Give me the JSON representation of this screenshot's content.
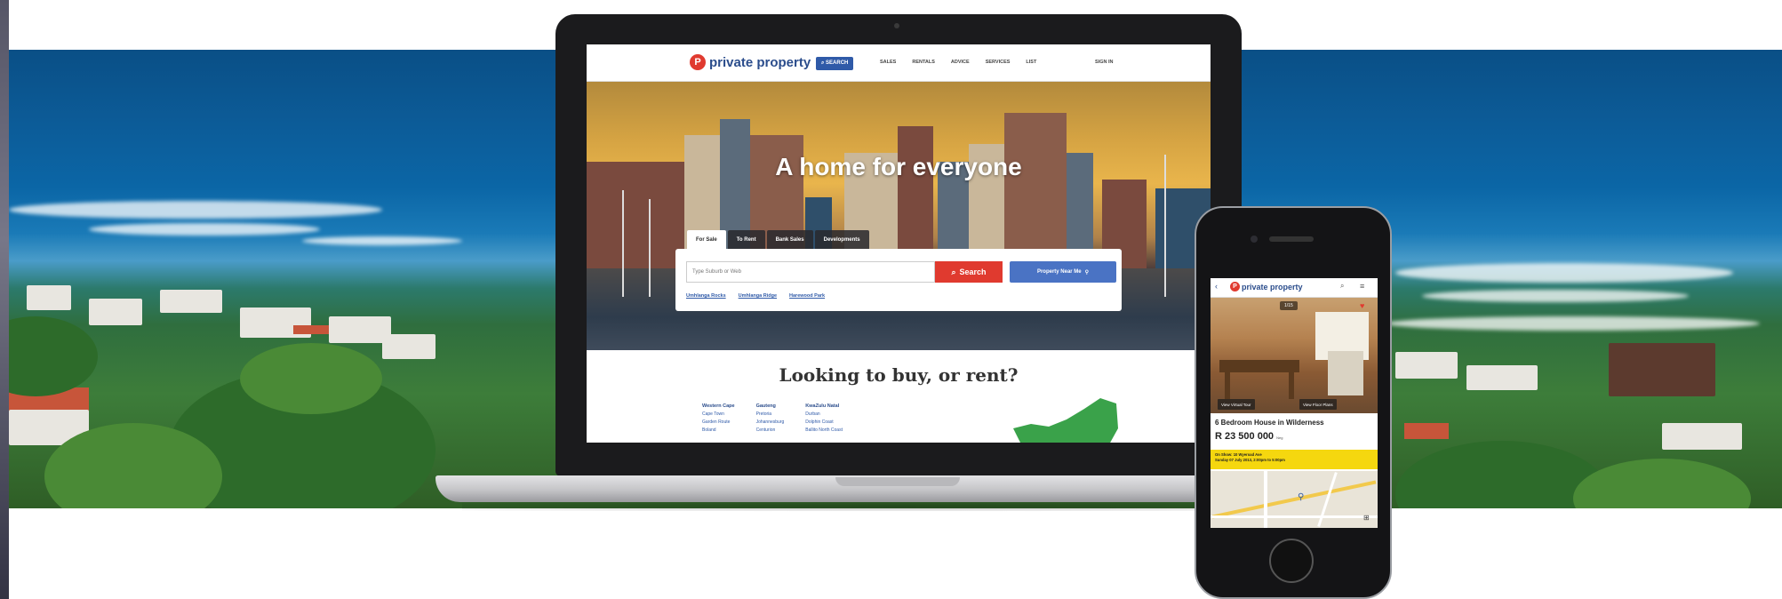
{
  "laptop": {
    "nav": {
      "logo_mark": "P",
      "logo_text": "private property",
      "search_label": "⌕ SEARCH",
      "links": [
        "SALES",
        "RENTALS",
        "ADVICE",
        "SERVICES",
        "LIST"
      ],
      "sign_in": "SIGN IN"
    },
    "hero": {
      "title": "A home for everyone",
      "tabs": [
        "For Sale",
        "To Rent",
        "Bank Sales",
        "Developments"
      ],
      "search_placeholder": "Type Suburb or Web",
      "search_button": "Search",
      "near_me_button": "Property Near Me",
      "quick_links": [
        "Umhlanga Rocks",
        "Umhlanga Ridge",
        "Harewood Park"
      ]
    },
    "lower": {
      "title": "Looking to buy, or rent?",
      "regions": [
        {
          "name": "Western Cape",
          "cities": [
            "Cape Town",
            "Garden Route",
            "Boland"
          ]
        },
        {
          "name": "Gauteng",
          "cities": [
            "Pretoria",
            "Johannesburg",
            "Centurion"
          ]
        },
        {
          "name": "KwaZulu Natal",
          "cities": [
            "Durban",
            "Dolphin Coast",
            "Ballito North Coast"
          ]
        }
      ]
    }
  },
  "phone": {
    "nav": {
      "back_icon": "chevron-left-icon",
      "logo_text": "private property"
    },
    "photo_counter": "1/15",
    "photo_buttons": [
      "View Virtual Tour",
      "View Floor Plans"
    ],
    "listing_title": "6 Bedroom House in Wilderness",
    "price": "R 23 500 000",
    "price_suffix": "Neg",
    "alert_lines": [
      "On Show: 10 Wyeroad Ave",
      "Sunday 07 July 2013, 2:00pm to 5:00pm"
    ]
  },
  "colors": {
    "brand_blue": "#2b4d8c",
    "brand_red": "#e03a2f",
    "alert_yellow": "#f5d70f"
  }
}
